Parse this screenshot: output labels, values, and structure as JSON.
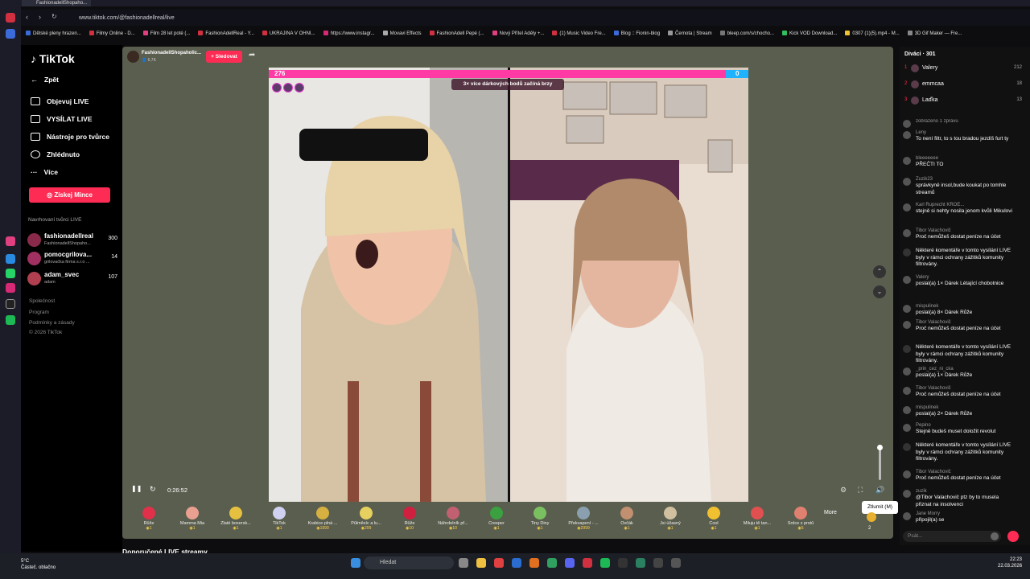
{
  "browser": {
    "tab_title": "FashionadellShopaho...",
    "url": "www.tiktok.com/@fashionadellreal/live",
    "bookmarks": [
      "Dětské pleny hrazen...",
      "Filmy Online - D...",
      "Film 28 let poté (...",
      "FashionAdellReal - Y...",
      "UKRAJINA V OHNI...",
      "https://www.instagr...",
      "Movavi Effects",
      "FashionAdell Pepé (...",
      "Nový Přítel Adély +...",
      "(1) Music Video Fre...",
      "Blog :: Fionin-blog",
      "Černota | Stream",
      "bleep.com/s/chocho...",
      "Kick VOD Download...",
      "0307 (1)(5).mp4 - M...",
      "3D Gif Maker — Fre..."
    ]
  },
  "sidebar": {
    "logo": "TikTok",
    "back": "Zpět",
    "items": [
      "Objevuj LIVE",
      "VYSÍLAT LIVE",
      "Nástroje pro tvůrce",
      "Zhlédnuto",
      "Více"
    ],
    "coins_button": "Získej Mince",
    "recommended_title": "Navrhovaní tvůrci LIVE",
    "creators": [
      {
        "name": "fashionadellreal",
        "sub": "FashionadellShopaho...",
        "count": "300"
      },
      {
        "name": "pomocgrilova...",
        "sub": "grilovačka firma s.r.o ...",
        "count": "14"
      },
      {
        "name": "adam_svec",
        "sub": "adam",
        "count": "107"
      }
    ],
    "footer": [
      "Společnost",
      "Program",
      "Podmínky a zásady",
      "© 2026 TikTok"
    ]
  },
  "live": {
    "host_name": "FashionadellShopaholic...",
    "host_viewers": "6,7K",
    "follow_label": "+ Sledovat",
    "score_left": "276",
    "score_right": "0",
    "boost_banner": "3× více dárkových bodů začíná brzy",
    "elapsed": "0:26:52",
    "tooltip": "Ztlumit (M)",
    "more_label": "More",
    "bottom_title": "Doporučené LIVE streamy",
    "last_gift_count": "2"
  },
  "gifts": [
    {
      "name": "Růže",
      "price": "1",
      "color": "#e0304a"
    },
    {
      "name": "Mamma Mia",
      "price": "1",
      "color": "#e9a090"
    },
    {
      "name": "Zlaté boxersk...",
      "price": "1",
      "color": "#e5c040"
    },
    {
      "name": "TikTok",
      "price": "1",
      "color": "#d0d0f0"
    },
    {
      "name": "Krabice plná ...",
      "price": "1999",
      "color": "#d6b040"
    },
    {
      "name": "Půlměsíc a lu...",
      "price": "299",
      "color": "#e6d060"
    },
    {
      "name": "Růže",
      "price": "10",
      "color": "#d02040"
    },
    {
      "name": "Náhrdelník př...",
      "price": "10",
      "color": "#c06070"
    },
    {
      "name": "Creeper",
      "price": "1",
      "color": "#3aa040"
    },
    {
      "name": "Tiny Diny",
      "price": "1",
      "color": "#7ac060"
    },
    {
      "name": "Překvapení - ...",
      "price": "2999",
      "color": "#8aa0b0"
    },
    {
      "name": "Ovčák",
      "price": "1",
      "color": "#c09070"
    },
    {
      "name": "Jsi úžasný",
      "price": "1",
      "color": "#d0c0a0"
    },
    {
      "name": "Cool",
      "price": "1",
      "color": "#f0c030"
    },
    {
      "name": "Miluju tě tan...",
      "price": "1",
      "color": "#e05050"
    },
    {
      "name": "Srdce z prstů",
      "price": "5",
      "color": "#e08070"
    }
  ],
  "chat": {
    "viewers_title": "Diváci · 301",
    "viewers": [
      {
        "name": "Valery",
        "points": "212"
      },
      {
        "name": "emmcaa",
        "points": "18"
      },
      {
        "name": "Laďka",
        "points": "13"
      }
    ],
    "messages": [
      {
        "user": "zobrazeno 1 zprávu",
        "text": ""
      },
      {
        "user": "Leny",
        "text": "To není filtr, to s tou bradou jezdíš furt ty"
      },
      {
        "user": "bleeeeeee",
        "text": "PŘEČTI TO"
      },
      {
        "user": "Zuzik23",
        "text": "správkyně insol,bude koukat po tomhle streamů"
      },
      {
        "user": "Karl Ruprecht KROE...",
        "text": "stejně si nehty nosila jenom kvůli Mikulovi"
      },
      {
        "user": "Tibor Valachovič",
        "text": "Proč nemůžeš dostat peníze na účet"
      },
      {
        "user": "",
        "text": "Některé komentáře v tomto vysílání LIVE byly v rámci ochrany zážitků komunity filtrovány."
      },
      {
        "user": "Valery",
        "text": "poslal(a) 1× Dárek Létající chobotnice"
      },
      {
        "user": "mispulinek",
        "text": "poslal(a) 8× Dárek Růže"
      },
      {
        "user": "Tibor Valachovič",
        "text": "Proč nemůžeš dostat peníze na účet"
      },
      {
        "user": "",
        "text": "Některé komentáře v tomto vysílání LIVE byly v rámci ochrany zážitků komunity filtrovány."
      },
      {
        "user": "_prin_cez_ni_cka",
        "text": "poslal(a) 1× Dárek Růže"
      },
      {
        "user": "Tibor Valachovič",
        "text": "Proč nemůžeš dostat peníze na účet"
      },
      {
        "user": "mispulinek",
        "text": "poslal(a) 2× Dárek Růže"
      },
      {
        "user": "Pepino",
        "text": "Stejně budeš muset doložit revolut"
      },
      {
        "user": "",
        "text": "Některé komentáře v tomto vysílání LIVE byly v rámci ochrany zážitků komunity filtrovány."
      },
      {
        "user": "Tibor Valachovič",
        "text": "Proč nemůžeš dostat peníze na účet"
      },
      {
        "user": "zuzik",
        "text": "@Tibor Valachovič ptz by to musela přiznat na insolvenci"
      },
      {
        "user": "Jane Morry",
        "text": "připojil(a) se"
      }
    ],
    "input_placeholder": "Psát..."
  },
  "taskbar": {
    "temp": "5°C",
    "weather": "Částeč. oblačno",
    "search": "Hledat",
    "time": "22:23",
    "date": "22.03.2026"
  }
}
